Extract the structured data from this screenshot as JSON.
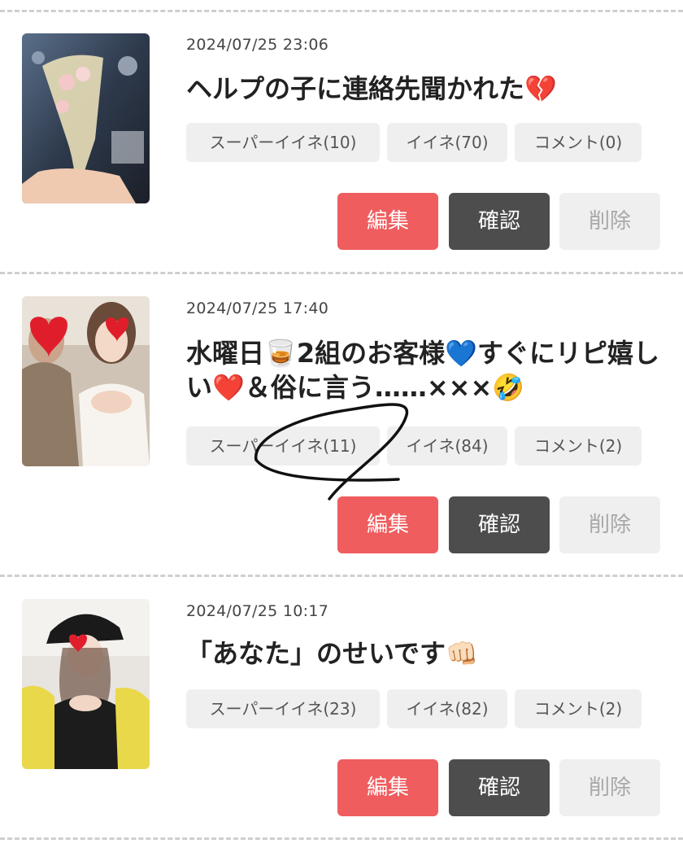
{
  "posts": [
    {
      "date": "2024/07/25 23:06",
      "title": "ヘルプの子に連絡先聞かれた💔",
      "super_like": "スーパーイイネ(10)",
      "like": "イイネ(70)",
      "comment": "コメント(0)",
      "edit": "編集",
      "confirm": "確認",
      "delete": "削除"
    },
    {
      "date": "2024/07/25 17:40",
      "title": "水曜日🥃2組のお客様💙すぐにリピ嬉しい❤️＆俗に言う……×××🤣",
      "super_like": "スーパーイイネ(11)",
      "like": "イイネ(84)",
      "comment": "コメント(2)",
      "edit": "編集",
      "confirm": "確認",
      "delete": "削除"
    },
    {
      "date": "2024/07/25 10:17",
      "title": "「あなた」のせいです👊🏻",
      "super_like": "スーパーイイネ(23)",
      "like": "イイネ(82)",
      "comment": "コメント(2)",
      "edit": "編集",
      "confirm": "確認",
      "delete": "削除"
    }
  ],
  "colors": {
    "edit": "#ef5d5f",
    "confirm": "#4d4d4d",
    "delete_bg": "#efefef",
    "chip_bg": "#efefef"
  }
}
